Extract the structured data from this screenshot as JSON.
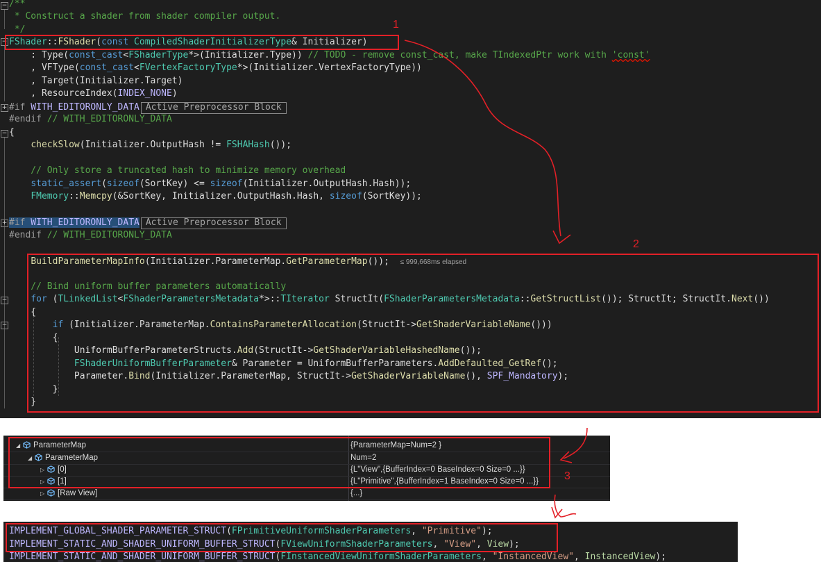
{
  "editor": {
    "line01": "/**",
    "line02": " * Construct a shader from shader compiler output.",
    "line03": " */",
    "l4_class": "FShader",
    "l4_sep": "::",
    "l4_ctor": "FShader",
    "l4_open": "(",
    "l4_const": "const",
    "l4_type": "CompiledShaderInitializerType",
    "l4_rest": "& Initializer)",
    "l5_a": "    : ",
    "l5_type": "Type",
    "l5_b": "(",
    "l5_cast": "const_cast",
    "l5_c": "<",
    "l5_ft": "FShaderType",
    "l5_d": "*>(Initializer.Type)) ",
    "l5_cmt1": "// TODO - remove const_cast, make TIndexedPtr work with ",
    "l5_cmt2": "'const'",
    "l6_a": "    , ",
    "l6_vf": "VFType",
    "l6_b": "(",
    "l6_cast": "const_cast",
    "l6_c": "<",
    "l6_t": "FVertexFactoryType",
    "l6_d": "*>(Initializer.VertexFactoryType))",
    "l7_a": "    , ",
    "l7_t": "Target",
    "l7_b": "(Initializer.Target)",
    "l8_a": "    , ",
    "l8_t": "ResourceIndex",
    "l8_b": "(",
    "l8_n": "INDEX_NONE",
    "l8_c": ")",
    "pp_if": "#if",
    "pp_macro": " WITH_EDITORONLY_DATA",
    "pp_tag": "Active Preprocessor Block",
    "pp_endif": "#endif",
    "pp_endcmt": " // WITH_EDITORONLY_DATA",
    "brace_open": "{",
    "brace_close": "}",
    "l12_a": "    ",
    "l12_fn": "checkSlow",
    "l12_b": "(Initializer.OutputHash != ",
    "l12_t": "FSHAHash",
    "l12_c": "());",
    "l14": "    // Only store a truncated hash to minimize memory overhead",
    "l15_a": "    ",
    "l15_kw": "static_assert",
    "l15_b": "(",
    "l15_kw2": "sizeof",
    "l15_c": "(SortKey) <= ",
    "l15_kw3": "sizeof",
    "l15_d": "(Initializer.OutputHash.Hash));",
    "l16_a": "    ",
    "l16_t": "FMemory",
    "l16_s": "::",
    "l16_fn": "Memcpy",
    "l16_b": "(&SortKey, Initializer.OutputHash.Hash, ",
    "l16_kw": "sizeof",
    "l16_c": "(SortKey));",
    "l21_a": "    ",
    "l21_fn": "BuildParameterMapInfo",
    "l21_b": "(Initializer.ParameterMap.",
    "l21_fn2": "GetParameterMap",
    "l21_c": "());",
    "l21_elapsed": "≤ 999,668ms elapsed",
    "l23": "    // Bind uniform buffer parameters automatically",
    "l24_a": "    ",
    "l24_kw": "for",
    "l24_b": " (",
    "l24_t1": "TLinkedList",
    "l24_c": "<",
    "l24_t2": "FShaderParametersMetadata",
    "l24_d": "*>::",
    "l24_t3": "TIterator",
    "l24_e": " StructIt(",
    "l24_t4": "FShaderParametersMetadata",
    "l24_f": "::",
    "l24_fn": "GetStructList",
    "l24_g": "()); StructIt; StructIt.",
    "l24_fn2": "Next",
    "l24_h": "())",
    "l25": "    {",
    "l26_a": "        ",
    "l26_kw": "if",
    "l26_b": " (Initializer.ParameterMap.",
    "l26_fn": "ContainsParameterAllocation",
    "l26_c": "(StructIt->",
    "l26_fn2": "GetShaderVariableName",
    "l26_d": "()))",
    "l27": "        {",
    "l28_a": "            UniformBufferParameterStructs.",
    "l28_fn": "Add",
    "l28_b": "(StructIt->",
    "l28_fn2": "GetShaderVariableHashedName",
    "l28_c": "());",
    "l29_a": "            ",
    "l29_t": "FShaderUniformBufferParameter",
    "l29_b": "& Parameter = UniformBufferParameters.",
    "l29_fn": "AddDefaulted_GetRef",
    "l29_c": "();",
    "l30_a": "            Parameter.",
    "l30_fn": "Bind",
    "l30_b": "(Initializer.ParameterMap, StructIt->",
    "l30_fn2": "GetShaderVariableName",
    "l30_c": "(), ",
    "l30_e": "SPF_Mandatory",
    "l30_d": ");",
    "l31": "        }",
    "l32": "    }"
  },
  "watch": {
    "rows": [
      {
        "name": "ParameterMap",
        "value": "{ParameterMap=Num=2 }"
      },
      {
        "name": "ParameterMap",
        "value": "Num=2"
      },
      {
        "name": "[0]",
        "value": "{L\"View\",{BufferIndex=0 BaseIndex=0 Size=0 ...}}"
      },
      {
        "name": "[1]",
        "value": "{L\"Primitive\",{BufferIndex=1 BaseIndex=0 Size=0 ...}}"
      },
      {
        "name": "[Raw View]",
        "value": "{...}"
      }
    ]
  },
  "bottom": {
    "b1_m": "IMPLEMENT_GLOBAL_SHADER_PARAMETER_STRUCT",
    "b1_a": "(",
    "b1_t": "FPrimitiveUniformShaderParameters",
    "b1_b": ", ",
    "b1_s": "\"Primitive\"",
    "b1_c": ");",
    "b2_m": "IMPLEMENT_STATIC_AND_SHADER_UNIFORM_BUFFER_STRUCT",
    "b2_a": "(",
    "b2_t": "FViewUniformShaderParameters",
    "b2_b": ", ",
    "b2_s": "\"View\"",
    "b2_c": ", ",
    "b2_v": "View",
    "b2_d": ");",
    "b3_m": "IMPLEMENT_STATIC_AND_SHADER_UNIFORM_BUFFER_STRUCT",
    "b3_a": "(",
    "b3_t": "FInstancedViewUniformShaderParameters",
    "b3_b": ", ",
    "b3_s": "\"InstancedView\"",
    "b3_c": ", ",
    "b3_v": "InstancedView",
    "b3_d": ");"
  },
  "annotations": {
    "label1": "1",
    "label2": "2",
    "label3": "3",
    "color": "#e32027"
  }
}
